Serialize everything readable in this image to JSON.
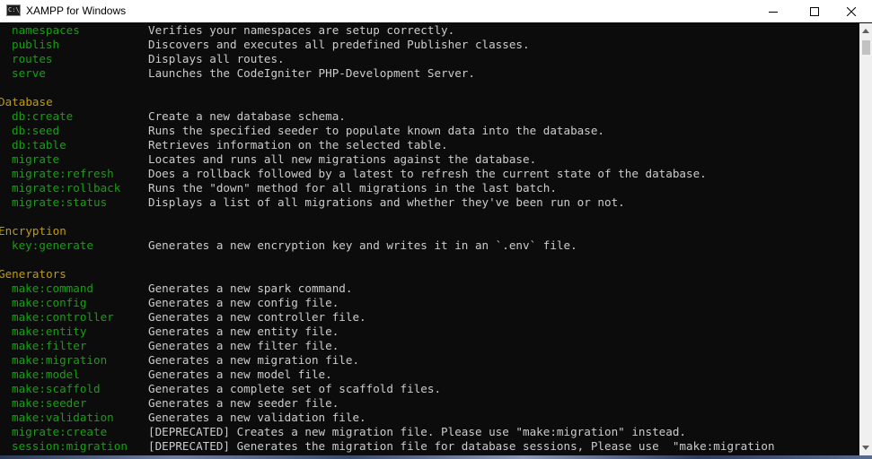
{
  "window": {
    "title": "XAMPP for Windows",
    "icon_text": "C:\\_"
  },
  "groups": [
    {
      "heading": "",
      "commands": [
        {
          "name": "namespaces",
          "description": "Verifies your namespaces are setup correctly."
        },
        {
          "name": "publish",
          "description": "Discovers and executes all predefined Publisher classes."
        },
        {
          "name": "routes",
          "description": "Displays all routes."
        },
        {
          "name": "serve",
          "description": "Launches the CodeIgniter PHP-Development Server."
        }
      ]
    },
    {
      "heading": "Database",
      "commands": [
        {
          "name": "db:create",
          "description": "Create a new database schema."
        },
        {
          "name": "db:seed",
          "description": "Runs the specified seeder to populate known data into the database."
        },
        {
          "name": "db:table",
          "description": "Retrieves information on the selected table."
        },
        {
          "name": "migrate",
          "description": "Locates and runs all new migrations against the database."
        },
        {
          "name": "migrate:refresh",
          "description": "Does a rollback followed by a latest to refresh the current state of the database."
        },
        {
          "name": "migrate:rollback",
          "description": "Runs the \"down\" method for all migrations in the last batch."
        },
        {
          "name": "migrate:status",
          "description": "Displays a list of all migrations and whether they've been run or not."
        }
      ]
    },
    {
      "heading": "Encryption",
      "commands": [
        {
          "name": "key:generate",
          "description": "Generates a new encryption key and writes it in an `.env` file."
        }
      ]
    },
    {
      "heading": "Generators",
      "commands": [
        {
          "name": "make:command",
          "description": "Generates a new spark command."
        },
        {
          "name": "make:config",
          "description": "Generates a new config file."
        },
        {
          "name": "make:controller",
          "description": "Generates a new controller file."
        },
        {
          "name": "make:entity",
          "description": "Generates a new entity file."
        },
        {
          "name": "make:filter",
          "description": "Generates a new filter file."
        },
        {
          "name": "make:migration",
          "description": "Generates a new migration file."
        },
        {
          "name": "make:model",
          "description": "Generates a new model file."
        },
        {
          "name": "make:scaffold",
          "description": "Generates a complete set of scaffold files."
        },
        {
          "name": "make:seeder",
          "description": "Generates a new seeder file."
        },
        {
          "name": "make:validation",
          "description": "Generates a new validation file."
        },
        {
          "name": "migrate:create",
          "description": "[DEPRECATED] Creates a new migration file. Please use \"make:migration\" instead."
        },
        {
          "name": "session:migration",
          "description": "[DEPRECATED] Generates the migration file for database sessions, Please use  \"make:migration"
        }
      ]
    }
  ],
  "colors": {
    "background": "#0c0c0c",
    "command": "#13a10e",
    "description": "#cccccc",
    "heading": "#c19c00"
  }
}
